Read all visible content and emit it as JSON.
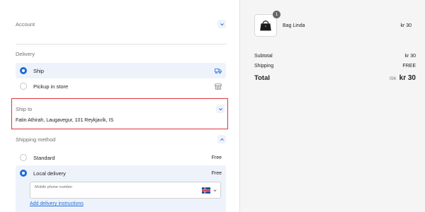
{
  "checkout": {
    "account": {
      "title": "Account"
    },
    "delivery": {
      "title": "Delivery",
      "options": [
        {
          "label": "Ship",
          "icon": "truck-icon",
          "selected": true
        },
        {
          "label": "Pickup in store",
          "icon": "store-icon",
          "selected": false
        }
      ]
    },
    "ship_to": {
      "title": "Ship to",
      "address": "Fatin Athirah, Laugavegur, 101 Reykjavík, IS"
    },
    "shipping_method": {
      "title": "Shipping method",
      "options": [
        {
          "label": "Standard",
          "price": "Free",
          "selected": false
        },
        {
          "label": "Local delivery",
          "price": "Free",
          "selected": true
        }
      ],
      "phone_placeholder": "Mobile phone number",
      "phone_country_flag": "iceland-flag-icon",
      "instructions_link": "Add delivery instructions"
    }
  },
  "summary": {
    "product": {
      "name": "Bag Linda",
      "price": "kr 30",
      "quantity": "1"
    },
    "subtotal": {
      "label": "Subtotal",
      "value": "kr 30"
    },
    "shipping": {
      "label": "Shipping",
      "value": "FREE"
    },
    "total": {
      "label": "Total",
      "currency": "ISK",
      "value": "kr 30"
    }
  },
  "colors": {
    "accent": "#1f6bd6",
    "highlight_border": "#d9363e",
    "selected_bg": "#eef3fb",
    "sidebar_bg": "#f5f5f5"
  }
}
